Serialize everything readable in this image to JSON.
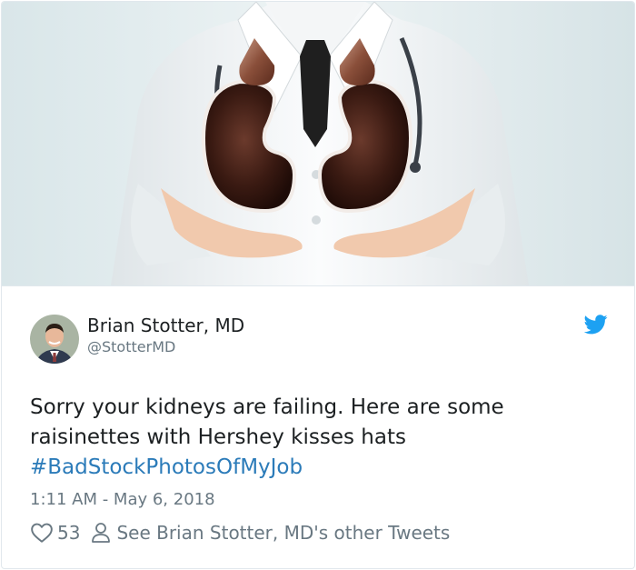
{
  "tweet": {
    "author_name": "Brian Stotter, MD",
    "handle": "@StotterMD",
    "text": "Sorry your kidneys are failing. Here are some raisinettes with Hershey kisses hats",
    "hashtag": "#BadStockPhotosOfMyJob",
    "timestamp": "1:11 AM - May 6, 2018",
    "likes": "53",
    "other_tweets_link": "See Brian Stotter, MD's other Tweets"
  },
  "icons": {
    "brand": "twitter-bird-icon",
    "like": "heart-icon",
    "profile": "person-icon"
  },
  "colors": {
    "brand_blue": "#1da1f2",
    "link_blue": "#2b7bb9",
    "text": "#1c2022",
    "muted": "#697882",
    "border": "#e1e8ed"
  }
}
